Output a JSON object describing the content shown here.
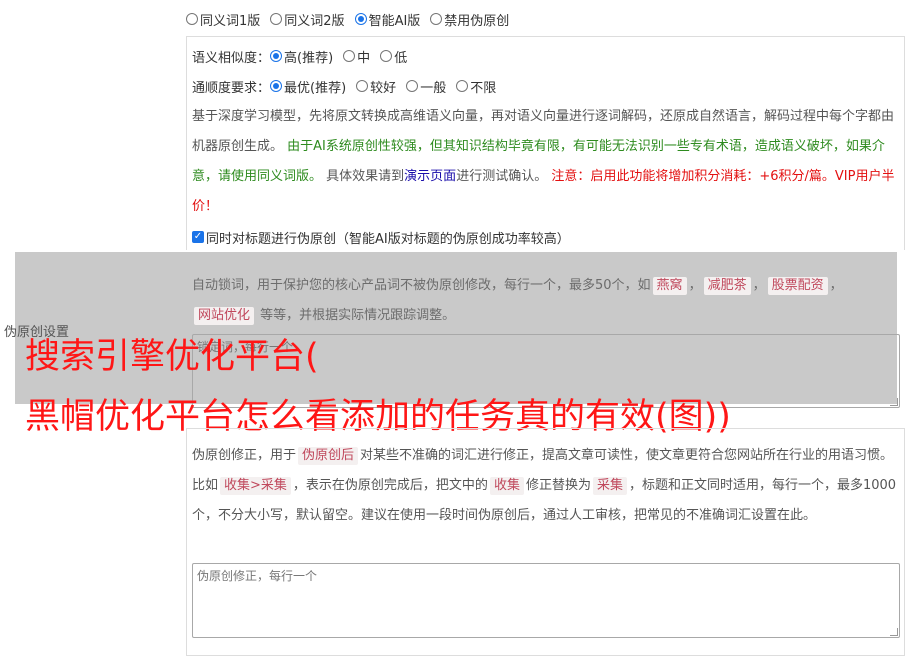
{
  "modes": [
    {
      "label": "同义词1版",
      "selected": false
    },
    {
      "label": "同义词2版",
      "selected": false
    },
    {
      "label": "智能AI版",
      "selected": true
    },
    {
      "label": "禁用伪原创",
      "selected": false
    }
  ],
  "similarity": {
    "label": "语义相似度：",
    "options": [
      {
        "label": "高(推荐)",
        "selected": true
      },
      {
        "label": "中",
        "selected": false
      },
      {
        "label": "低",
        "selected": false
      }
    ]
  },
  "fluency": {
    "label": "通顺度要求：",
    "options": [
      {
        "label": "最优(推荐)",
        "selected": true
      },
      {
        "label": "较好",
        "selected": false
      },
      {
        "label": "一般",
        "selected": false
      },
      {
        "label": "不限",
        "selected": false
      }
    ]
  },
  "description": {
    "intro": "基于深度学习模型，先将原文转换成高维语义向量，再对语义向量进行逐词解码，还原成自然语言，解码过程中每个字都由机器原创生成。",
    "warning_green": "由于AI系统原创性较强，但其知识结构毕竟有限，有可能无法识别一些专有术语，造成语义破坏，如果介意，请使用同义词版。",
    "test_prefix": "具体效果请到",
    "test_link": "演示页面",
    "test_suffix": "进行测试确认。",
    "notice_red": "注意：启用此功能将增加积分消耗：+6积分/篇。VIP用户半价！"
  },
  "title_option": {
    "label": "同时对标题进行伪原创（智能AI版对标题的伪原创成功率较高）",
    "checked": true
  },
  "lock": {
    "desc_prefix": "自动锁词，用于保护您的核心产品词不被伪原创修改，每行一个，最多50个，如",
    "examples": [
      "燕窝",
      "减肥茶",
      "股票配资",
      "网站优化"
    ],
    "sep": "，",
    "desc_suffix": "等等，并根据实际情况跟踪调整。",
    "placeholder": "锁定词，每行一个"
  },
  "side_label": "伪原创设置",
  "headline": {
    "line1": "搜索引擎优化平台(",
    "line2": "黑帽优化平台怎么看添加的任务真的有效(图))"
  },
  "correction": {
    "p1_prefix": "伪原创修正，用于",
    "p1_tag": "伪原创后",
    "p1_suffix": "对某些不准确的词汇进行修正，提高文章可读性，使文章更符合您网站所在行业的用语习惯。比如",
    "tag_example": "收集>采集",
    "p2": "，表示在伪原创完成后，把文中的",
    "tag_from": "收集",
    "p3": "修正替换为",
    "tag_to": "采集",
    "p4": "，标题和正文同时适用，每行一个，最多1000个，不分大小写，默认留空。建议在使用一段时间伪原创后，通过人工审核，把常见的不准确词汇设置在此。",
    "placeholder": "伪原创修正，每行一个"
  },
  "colors": {
    "accent": "#1a73e8",
    "green": "#2e8b1f",
    "red": "#e31010",
    "headline": "#ff1616",
    "overlay": "#c9c9c9"
  }
}
